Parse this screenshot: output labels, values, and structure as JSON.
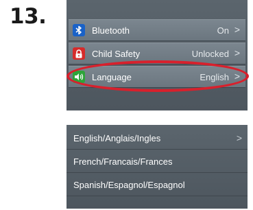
{
  "step": {
    "number": "13."
  },
  "settings": {
    "rows": [
      {
        "label": "Bluetooth",
        "value": "On",
        "chevron": ">"
      },
      {
        "label": "Child Safety",
        "value": "Unlocked",
        "chevron": ">"
      },
      {
        "label": "Language",
        "value": "English",
        "chevron": ">"
      }
    ],
    "highlight_color": "#d8202c"
  },
  "language_menu": {
    "options": [
      {
        "label": "English/Anglais/Ingles",
        "chevron": ">"
      },
      {
        "label": "French/Francais/Frances"
      },
      {
        "label": "Spanish/Espagnol/Espagnol"
      }
    ]
  },
  "icons": {
    "bluetooth": "bluetooth-icon",
    "child_safety": "lock-icon",
    "language": "speaker-icon"
  }
}
